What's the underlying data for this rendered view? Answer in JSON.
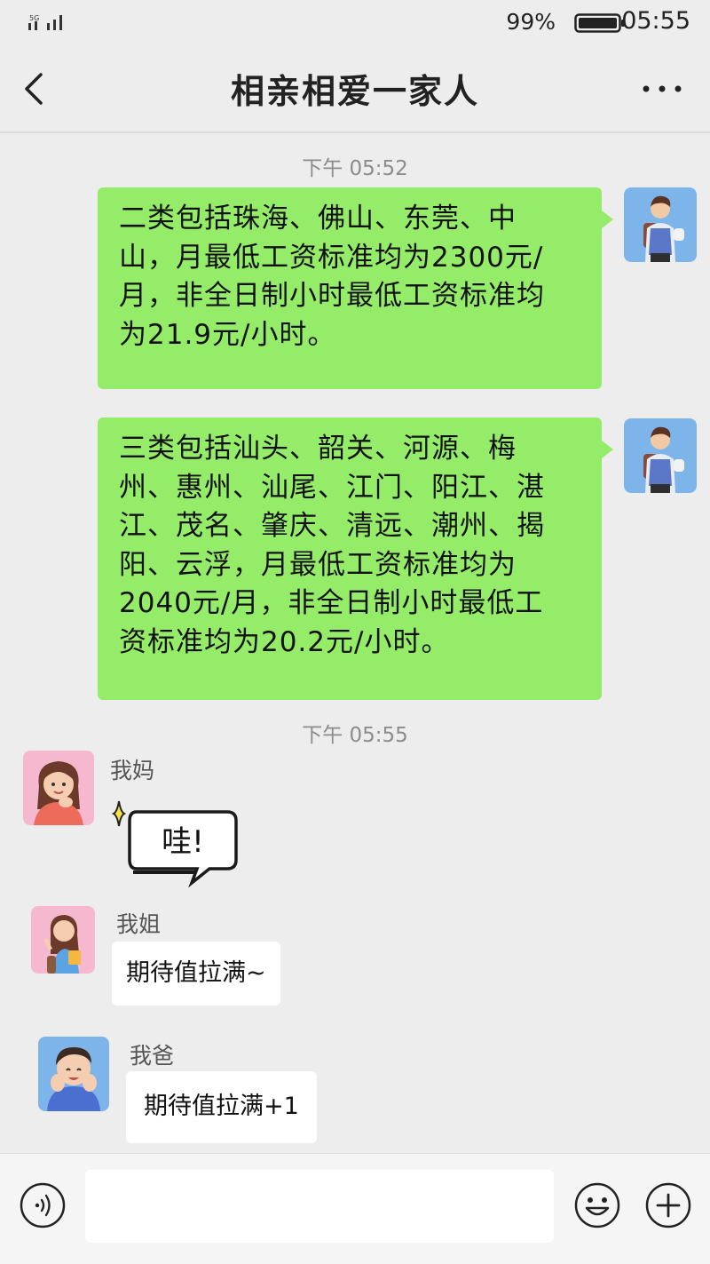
{
  "status_bar": {
    "network": "5G",
    "battery_percent": "99%",
    "time": "05:55"
  },
  "header": {
    "title": "相亲相爱一家人",
    "back_icon": "chevron-left-icon",
    "more_icon": "more-dots-icon"
  },
  "timestamps": [
    "下午 05:52",
    "下午 05:55"
  ],
  "messages": [
    {
      "side": "right",
      "avatar": "boy-backpack-avatar",
      "lines": [
        "二类包括珠海、佛山、东莞、中",
        "山，月最低工资标准均为2300元/",
        "月，非全日制小时最低工资标准均",
        "为21.9元/小时。"
      ]
    },
    {
      "side": "right",
      "avatar": "boy-backpack-avatar",
      "lines": [
        "三类包括汕头、韶关、河源、梅",
        "州、惠州、汕尾、江门、阳江、湛",
        "江、茂名、肇庆、清远、潮州、揭",
        "阳、云浮，月最低工资标准均为",
        "2040元/月，非全日制小时最低工",
        "资标准均为20.2元/小时。"
      ]
    },
    {
      "side": "left",
      "sender": "我妈",
      "avatar": "woman-pink-avatar",
      "sticker_text": "哇!"
    },
    {
      "side": "left",
      "sender": "我姐",
      "avatar": "girl-waving-avatar",
      "text": "期待值拉满~"
    },
    {
      "side": "left",
      "sender": "我爸",
      "avatar": "man-blue-avatar",
      "text": "期待值拉满+1"
    }
  ],
  "input_bar": {
    "placeholder": "",
    "voice_icon": "voice-icon",
    "emoji_icon": "emoji-icon",
    "plus_icon": "plus-icon"
  },
  "colors": {
    "background": "#ededed",
    "sent_bubble": "#95ec69",
    "received_bubble": "#ffffff"
  }
}
